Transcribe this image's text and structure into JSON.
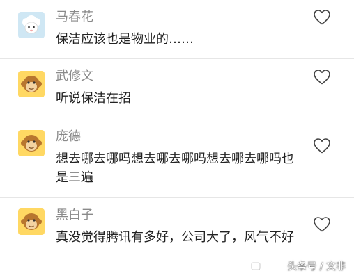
{
  "comments": [
    {
      "username": "马春花",
      "text": "保洁应该也是物业的……",
      "avatar": "sheep-avatar-icon"
    },
    {
      "username": "武修文",
      "text": "听说保洁在招",
      "avatar": "monkey-avatar-icon"
    },
    {
      "username": "庞德",
      "text": "想去哪去哪吗想去哪去哪吗想去哪去哪吗也是三遍",
      "avatar": "monkey-avatar-icon"
    },
    {
      "username": "黑白子",
      "text": "真没觉得腾讯有多好，公司大了，风气不好",
      "avatar": "monkey-avatar-icon"
    }
  ],
  "watermark": "头条号 / 文非",
  "colors": {
    "username": "#8a8a8a",
    "text": "#222222",
    "divider": "#e6e6e6",
    "avatar_bg": "#ffd863"
  }
}
